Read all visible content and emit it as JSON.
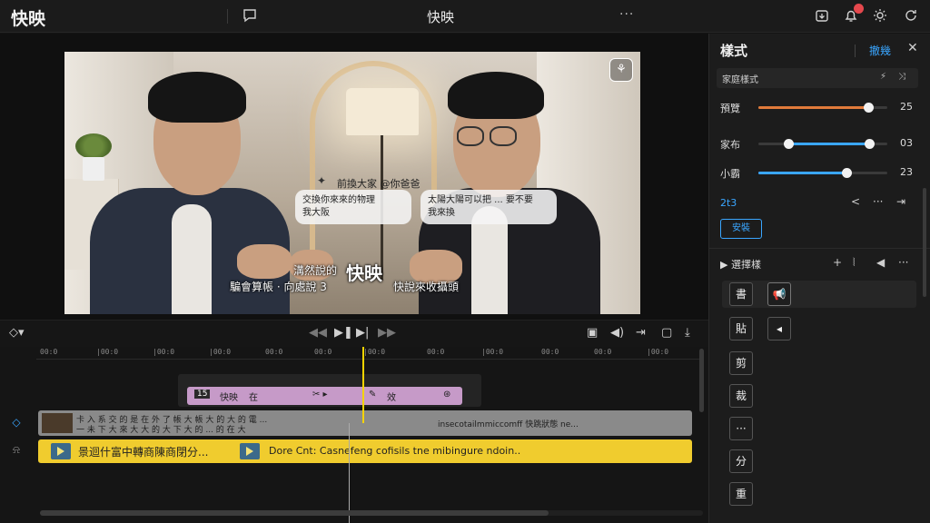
{
  "topbar": {
    "app_title": "快映",
    "center_title": "快映",
    "more": "···",
    "icons": [
      "comment-icon",
      "export-icon",
      "notification-icon",
      "settings-icon",
      "refresh-icon"
    ]
  },
  "preview": {
    "bubble_title": "前換大家 @你爸爸",
    "bubble_left": [
      "交換你來來的物理",
      "我大阪"
    ],
    "bubble_right": [
      "太陽大陽可以把 ... 要不要",
      "我來換"
    ],
    "subtitle_top": "溝然說的",
    "subtitle_main": "快映",
    "subtitle_left": "騙會算帳 · 向處說 3",
    "subtitle_right": "快說來收攝頭"
  },
  "controls": {
    "icons": [
      "keyframe-icon",
      "rewind-icon",
      "play-pause-icon",
      "play-icon",
      "fast-forward-icon",
      "snapshot-icon",
      "volume-icon",
      "split-icon",
      "crop-icon",
      "download-icon"
    ]
  },
  "timeline": {
    "ticks": [
      "00:0",
      "|00:0",
      "|00:0",
      "|00:0",
      "00:0",
      "00:0",
      "|00:0",
      "00:0",
      "|00:0",
      "00:0",
      "00:0",
      "|00:0"
    ],
    "pink_clip": {
      "tag": "15",
      "label": "快映",
      "meta": "在",
      "extra": "效"
    },
    "grey_clip": {
      "line1": "卡 入 系 交 的 是 在 外 了 帳 大 帳 大 的 大 的 電 ...",
      "line2": "一 未 下 大 來 大 大 的 大 下 大 的 ... 的 在 大",
      "right": "insecotailmmiccomff 快跳狀態 ne..."
    },
    "yellow_clip": {
      "left": "景迴什富中轉商陳商閉分...",
      "right": "Dore Cnt: Casnefeng cofisils tne mibingure ndoin.."
    }
  },
  "panel": {
    "title": "樣式",
    "link": "撤幾",
    "close": "✕",
    "preset": "家庭樣式",
    "sliders": [
      {
        "label": "預覽",
        "value": "25",
        "fraction": 0.85,
        "color": "#e07a3a"
      },
      {
        "label": "家布",
        "value": "03",
        "fraction": 0.86,
        "start": 0.23,
        "color": "#3aa6ff"
      },
      {
        "label": "小霸",
        "value": "23",
        "fraction": 0.68,
        "color": "#3aa6ff"
      }
    ],
    "blue_text": "2t3",
    "blue_button": "安裝",
    "section_label": "選擇樣",
    "tools": [
      "書",
      "貼",
      "剪",
      "裁",
      "···",
      "分",
      "重"
    ]
  }
}
